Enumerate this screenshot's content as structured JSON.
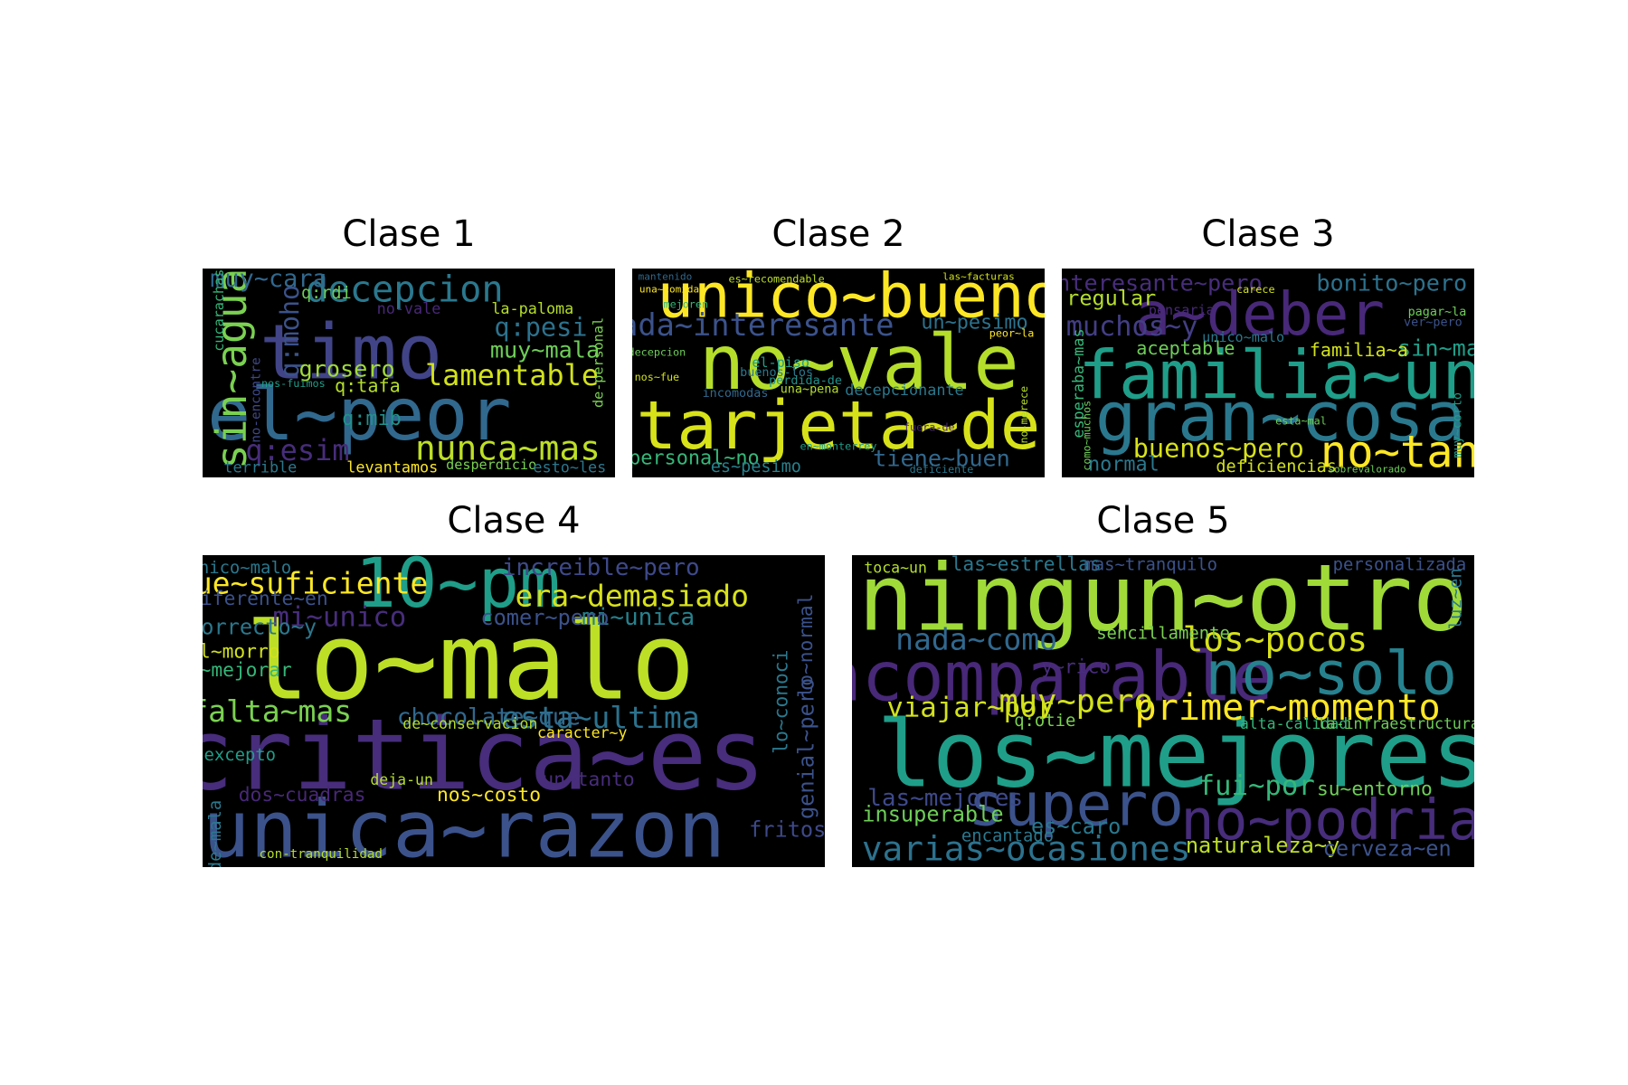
{
  "chart_data": [
    {
      "type": "wordcloud",
      "title": "Clase 1",
      "background": "#000000",
      "words": [
        {
          "text": "timo",
          "weight": 100,
          "color": "#414487"
        },
        {
          "text": "el~peor",
          "weight": 95,
          "color": "#31688e"
        },
        {
          "text": "sin~agua",
          "weight": 55,
          "color": "#7ad151",
          "vertical": true
        },
        {
          "text": "decepcion",
          "weight": 48,
          "color": "#2a788e"
        },
        {
          "text": "nunca~mas",
          "weight": 45,
          "color": "#bddf26"
        },
        {
          "text": "lamentable",
          "weight": 38,
          "color": "#d2e21b"
        },
        {
          "text": "q:esim",
          "weight": 38,
          "color": "#472d7b"
        },
        {
          "text": "q:pesi",
          "weight": 34,
          "color": "#2c728e"
        },
        {
          "text": "muy~cara",
          "weight": 32,
          "color": "#31688e"
        },
        {
          "text": "q:moho",
          "weight": 34,
          "color": "#3b528b",
          "vertical": true
        },
        {
          "text": "grosero",
          "weight": 30,
          "color": "#a0da39"
        },
        {
          "text": "muy~mala",
          "weight": 30,
          "color": "#6ece58"
        },
        {
          "text": "q:mib",
          "weight": 26,
          "color": "#21918c"
        },
        {
          "text": "q:tafa",
          "weight": 24,
          "color": "#b5de2b"
        },
        {
          "text": "q:rdi",
          "weight": 22,
          "color": "#6ece58"
        },
        {
          "text": "la-paloma",
          "weight": 20,
          "color": "#b5de2b"
        },
        {
          "text": "no-vale",
          "weight": 20,
          "color": "#482878"
        },
        {
          "text": "cucarachas",
          "weight": 18,
          "color": "#35b779",
          "vertical": true
        },
        {
          "text": "de-personal",
          "weight": 18,
          "color": "#7ad151",
          "vertical": true
        },
        {
          "text": "no-encontre",
          "weight": 17,
          "color": "#3e4989",
          "vertical": true
        },
        {
          "text": "terrible",
          "weight": 20,
          "color": "#2a788e"
        },
        {
          "text": "levantamos",
          "weight": 20,
          "color": "#fde725"
        },
        {
          "text": "desperdicio",
          "weight": 18,
          "color": "#7ad151"
        },
        {
          "text": "esto~les",
          "weight": 20,
          "color": "#2a788e"
        },
        {
          "text": "nos-fuimos",
          "weight": 14,
          "color": "#1f9e89"
        }
      ]
    },
    {
      "type": "wordcloud",
      "title": "Clase 2",
      "background": "#000000",
      "words": [
        {
          "text": "unico~bueno",
          "weight": 82,
          "color": "#fde725"
        },
        {
          "text": "no~vale",
          "weight": 100,
          "color": "#b5de2b"
        },
        {
          "text": "tarjeta~de",
          "weight": 92,
          "color": "#d8e219"
        },
        {
          "text": "nada~interesante",
          "weight": 40,
          "color": "#3b528b"
        },
        {
          "text": "un~pesimo",
          "weight": 26,
          "color": "#2c728e"
        },
        {
          "text": "personal~no",
          "weight": 26,
          "color": "#35b779"
        },
        {
          "text": "tiene~buen",
          "weight": 30,
          "color": "#31688e"
        },
        {
          "text": "es~pesimo",
          "weight": 22,
          "color": "#26828e"
        },
        {
          "text": "decepcionante",
          "weight": 20,
          "color": "#2a788e"
        },
        {
          "text": "el-piso",
          "weight": 18,
          "color": "#1f9e89"
        },
        {
          "text": "buenos-los",
          "weight": 16,
          "color": "#2a788e"
        },
        {
          "text": "perdida-de",
          "weight": 16,
          "color": "#21918c"
        },
        {
          "text": "una~pena",
          "weight": 16,
          "color": "#b5de2b"
        },
        {
          "text": "incomodas",
          "weight": 16,
          "color": "#31688e"
        },
        {
          "text": "no-merece",
          "weight": 14,
          "color": "#b5de2b",
          "vertical": true
        },
        {
          "text": "es~recomendable",
          "weight": 14,
          "color": "#bddf26"
        },
        {
          "text": "fuera-de",
          "weight": 14,
          "color": "#482878"
        },
        {
          "text": "en~monterrey",
          "weight": 14,
          "color": "#1f9e89"
        },
        {
          "text": "deficiente",
          "weight": 14,
          "color": "#2a788e"
        },
        {
          "text": "decepcion",
          "weight": 14,
          "color": "#6ece58"
        },
        {
          "text": "nos~fue",
          "weight": 14,
          "color": "#d2e21b"
        },
        {
          "text": "mejoren",
          "weight": 14,
          "color": "#35b779"
        },
        {
          "text": "mantenido",
          "weight": 12,
          "color": "#31688e"
        },
        {
          "text": "una~comida",
          "weight": 12,
          "color": "#fde725"
        },
        {
          "text": "las~facturas",
          "weight": 12,
          "color": "#d2e21b"
        },
        {
          "text": "peor~la",
          "weight": 14,
          "color": "#fde725"
        }
      ]
    },
    {
      "type": "wordcloud",
      "title": "Clase 3",
      "background": "#000000",
      "words": [
        {
          "text": "familia~un",
          "weight": 100,
          "color": "#1f9e89"
        },
        {
          "text": "gran~cosa",
          "weight": 90,
          "color": "#2a788e"
        },
        {
          "text": "a~deber",
          "weight": 78,
          "color": "#482878"
        },
        {
          "text": "no~tan",
          "weight": 58,
          "color": "#fde725"
        },
        {
          "text": "buenos~pero",
          "weight": 34,
          "color": "#d8e219"
        },
        {
          "text": "interesante~pero",
          "weight": 30,
          "color": "#472d7b"
        },
        {
          "text": "muchos~y",
          "weight": 36,
          "color": "#433e85"
        },
        {
          "text": "bonito~pero",
          "weight": 30,
          "color": "#2c728e"
        },
        {
          "text": "sin~mas",
          "weight": 30,
          "color": "#1f9e89"
        },
        {
          "text": "regular",
          "weight": 28,
          "color": "#b5de2b"
        },
        {
          "text": "familia~a",
          "weight": 24,
          "color": "#d2e21b"
        },
        {
          "text": "aceptable",
          "weight": 24,
          "color": "#6ece58"
        },
        {
          "text": "unico~malo",
          "weight": 18,
          "color": "#2a788e"
        },
        {
          "text": "normal",
          "weight": 26,
          "color": "#2a788e"
        },
        {
          "text": "deficiencias",
          "weight": 22,
          "color": "#d2e21b"
        },
        {
          "text": "esperaba~mas",
          "weight": 20,
          "color": "#35b779",
          "vertical": true
        },
        {
          "text": "pensaria",
          "weight": 18,
          "color": "#482878"
        },
        {
          "text": "pagar~la",
          "weight": 16,
          "color": "#6ece58"
        },
        {
          "text": "ver~pero",
          "weight": 16,
          "color": "#3b528b"
        },
        {
          "text": "esta~mal",
          "weight": 14,
          "color": "#6ece58"
        },
        {
          "text": "muy~corto",
          "weight": 16,
          "color": "#1f9e89",
          "vertical": true
        },
        {
          "text": "sobrevalorado",
          "weight": 12,
          "color": "#6ece58"
        },
        {
          "text": "carece",
          "weight": 14,
          "color": "#d2e21b"
        },
        {
          "text": "como~muchos",
          "weight": 14,
          "color": "#6ece58",
          "vertical": true
        }
      ]
    },
    {
      "type": "wordcloud",
      "title": "Clase 4",
      "background": "#000000",
      "words": [
        {
          "text": "lo~malo",
          "weight": 100,
          "color": "#bddf26"
        },
        {
          "text": "critica~es",
          "weight": 92,
          "color": "#472d7b"
        },
        {
          "text": "unica~razon",
          "weight": 74,
          "color": "#3b528b"
        },
        {
          "text": "10~pm",
          "weight": 64,
          "color": "#1f9e89"
        },
        {
          "text": "que~suficiente",
          "weight": 28,
          "color": "#fde725"
        },
        {
          "text": "era~demasiado",
          "weight": 28,
          "color": "#d8e219"
        },
        {
          "text": "increible~pero",
          "weight": 22,
          "color": "#3e4989"
        },
        {
          "text": "mi~unico",
          "weight": 26,
          "color": "#472d7b"
        },
        {
          "text": "mi~unica",
          "weight": 22,
          "color": "#26828e"
        },
        {
          "text": "comer~pero",
          "weight": 20,
          "color": "#3b528b"
        },
        {
          "text": "esta~ultima",
          "weight": 28,
          "color": "#2c728e"
        },
        {
          "text": "chocolate~que",
          "weight": 22,
          "color": "#31688e"
        },
        {
          "text": "falta~mas",
          "weight": 28,
          "color": "#7ad151"
        },
        {
          "text": "correcto~y",
          "weight": 20,
          "color": "#2a788e"
        },
        {
          "text": "el~morro",
          "weight": 18,
          "color": "#d2e21b"
        },
        {
          "text": "a~mejorar",
          "weight": 18,
          "color": "#35b779"
        },
        {
          "text": "diferente~en",
          "weight": 18,
          "color": "#3b528b"
        },
        {
          "text": "unico~malo",
          "weight": 16,
          "color": "#2a788e"
        },
        {
          "text": "nos~costo",
          "weight": 18,
          "color": "#fde725"
        },
        {
          "text": "dos~cuadras",
          "weight": 18,
          "color": "#482878"
        },
        {
          "text": "un~tanto",
          "weight": 18,
          "color": "#472d7b"
        },
        {
          "text": "fritos",
          "weight": 20,
          "color": "#3e4989"
        },
        {
          "text": "genial~pero",
          "weight": 20,
          "color": "#3b528b",
          "vertical": true
        },
        {
          "text": "lo~conoci",
          "weight": 18,
          "color": "#2a788e",
          "vertical": true
        },
        {
          "text": "lo~normal",
          "weight": 18,
          "color": "#3b528b",
          "vertical": true
        },
        {
          "text": "excepto",
          "weight": 16,
          "color": "#1f9e89"
        },
        {
          "text": "caracter~y",
          "weight": 14,
          "color": "#fde725"
        },
        {
          "text": "de~conservacion",
          "weight": 14,
          "color": "#b5de2b"
        },
        {
          "text": "con-tranquilidad",
          "weight": 12,
          "color": "#b5de2b"
        },
        {
          "text": "deja-un",
          "weight": 14,
          "color": "#b5de2b"
        },
        {
          "text": "de~mala",
          "weight": 16,
          "color": "#2a788e",
          "vertical": true
        }
      ]
    },
    {
      "type": "wordcloud",
      "title": "Clase 5",
      "background": "#000000",
      "words": [
        {
          "text": "ningun~otro",
          "weight": 100,
          "color": "#a0da39"
        },
        {
          "text": "los~mejores",
          "weight": 96,
          "color": "#1f9e89"
        },
        {
          "text": "incomparable",
          "weight": 64,
          "color": "#482878"
        },
        {
          "text": "no~solo",
          "weight": 56,
          "color": "#26828e"
        },
        {
          "text": "supero",
          "weight": 56,
          "color": "#3b528b"
        },
        {
          "text": "no~podria",
          "weight": 52,
          "color": "#472d7b"
        },
        {
          "text": "primer~momento",
          "weight": 34,
          "color": "#fde725"
        },
        {
          "text": "los~pocos",
          "weight": 32,
          "color": "#d8e219"
        },
        {
          "text": "varias~ocasiones",
          "weight": 32,
          "color": "#2c728e"
        },
        {
          "text": "nada~como",
          "weight": 28,
          "color": "#31688e"
        },
        {
          "text": "muy~pero",
          "weight": 30,
          "color": "#d2e21b"
        },
        {
          "text": "viajar~por",
          "weight": 26,
          "color": "#d2e21b"
        },
        {
          "text": "fui~por",
          "weight": 26,
          "color": "#35b779"
        },
        {
          "text": "las~mejores",
          "weight": 22,
          "color": "#3e4989"
        },
        {
          "text": "insuperable",
          "weight": 20,
          "color": "#6ece58"
        },
        {
          "text": "es~caro",
          "weight": 20,
          "color": "#2a788e"
        },
        {
          "text": "naturaleza~y",
          "weight": 20,
          "color": "#bddf26"
        },
        {
          "text": "cerveza~en",
          "weight": 20,
          "color": "#3b528b"
        },
        {
          "text": "las~estrellas",
          "weight": 18,
          "color": "#2a788e"
        },
        {
          "text": "mas~tranquilo",
          "weight": 16,
          "color": "#3b528b"
        },
        {
          "text": "personalizada",
          "weight": 16,
          "color": "#3b528b"
        },
        {
          "text": "su~entorno",
          "weight": 18,
          "color": "#6ece58"
        },
        {
          "text": "sencillamente",
          "weight": 16,
          "color": "#7ad151"
        },
        {
          "text": "y~rico",
          "weight": 18,
          "color": "#472d7b"
        },
        {
          "text": "encantado",
          "weight": 16,
          "color": "#2a788e"
        },
        {
          "text": "q:otie",
          "weight": 16,
          "color": "#7ad151"
        },
        {
          "text": "toca~un",
          "weight": 14,
          "color": "#b5de2b"
        },
        {
          "text": "luz~en",
          "weight": 16,
          "color": "#2a788e",
          "vertical": true
        },
        {
          "text": "alta-calidad",
          "weight": 14,
          "color": "#35b779"
        },
        {
          "text": "la-infraestructura-de",
          "weight": 14,
          "color": "#6ece58"
        }
      ]
    }
  ]
}
